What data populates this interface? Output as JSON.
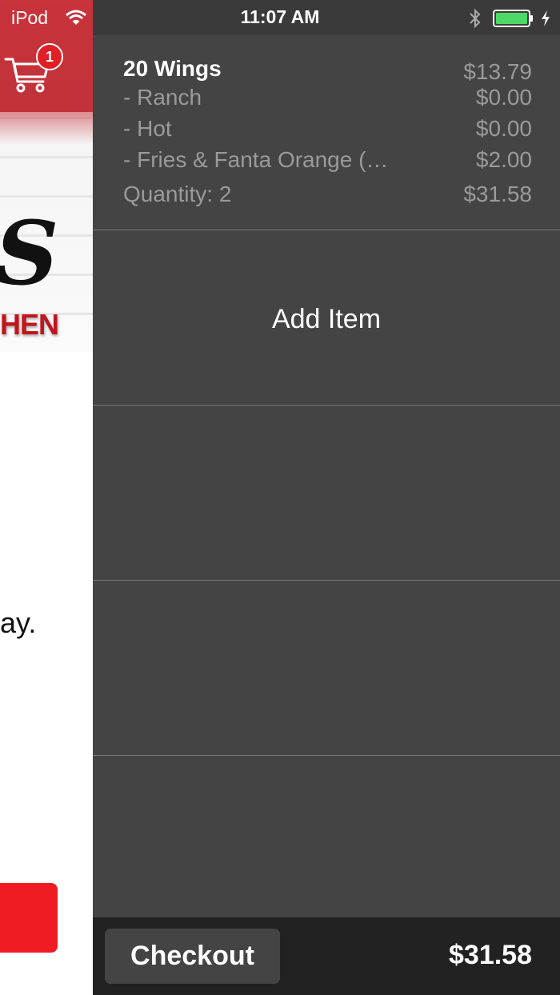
{
  "status_bar": {
    "carrier": "iPod",
    "time": "11:07 AM",
    "battery_color": "#4cd964"
  },
  "background_app": {
    "cart_badge_count": "1",
    "logo_letter": "S",
    "logo_subtext": "HEN",
    "body_text_fragment": "ay.",
    "accent_color": "#c9333b"
  },
  "cart": {
    "item": {
      "name": "20 Wings",
      "price": "$13.79",
      "options": [
        {
          "label": " - Ranch",
          "price": "$0.00"
        },
        {
          "label": " - Hot",
          "price": "$0.00"
        },
        {
          "label": " - Fries & Fanta Orange (…",
          "price": "$2.00"
        }
      ],
      "quantity_label": "Quantity: 2",
      "line_total": "$31.58"
    },
    "add_item_label": "Add Item"
  },
  "footer": {
    "checkout_label": "Checkout",
    "total": "$31.58"
  }
}
